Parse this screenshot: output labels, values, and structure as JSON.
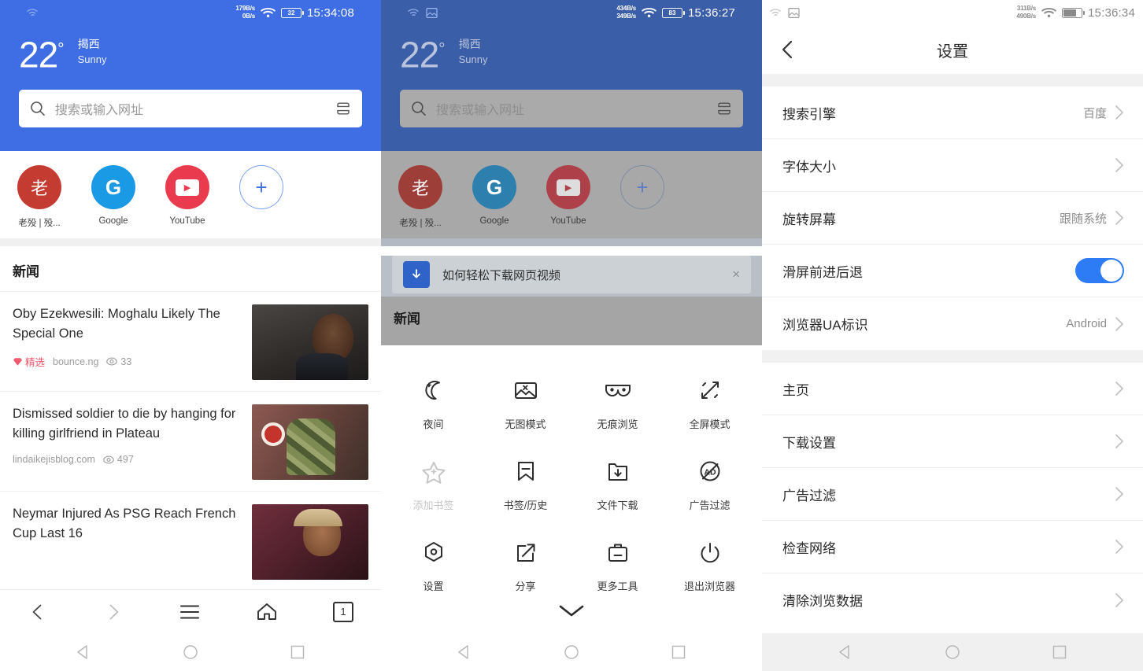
{
  "panel1": {
    "status": {
      "speed_up": "179B/s",
      "speed_down": "0B/s",
      "battery": "32",
      "time": "15:34:08"
    },
    "weather": {
      "temp": "22",
      "degree": "°",
      "city": "揭西",
      "condition": "Sunny"
    },
    "search": {
      "placeholder": "搜索或输入网址"
    },
    "shortcuts": [
      {
        "label": "老殁 | 殁...",
        "glyph": "老",
        "color": "#c43b32"
      },
      {
        "label": "Google",
        "glyph": "G",
        "color": "#1a9ae4"
      },
      {
        "label": "YouTube",
        "glyph": "▶",
        "color": "#e93b4d"
      },
      {
        "label": "",
        "glyph": "+",
        "color": ""
      }
    ],
    "news_heading": "新闻",
    "news": [
      {
        "title": "Oby Ezekwesili: Moghalu Likely The Special One",
        "badge": "精选",
        "source": "bounce.ng",
        "views": "33"
      },
      {
        "title": "Dismissed soldier to die by hanging for killing girlfriend in Plateau",
        "badge": "",
        "source": "lindaikejisblog.com",
        "views": "497"
      },
      {
        "title": "Neymar Injured As PSG Reach French Cup Last 16",
        "badge": "",
        "source": "",
        "views": ""
      }
    ],
    "toolbar": {
      "back": "back-icon",
      "forward": "forward-icon",
      "menu": "menu-icon",
      "home": "home-icon",
      "tabs": "1"
    }
  },
  "panel2": {
    "status": {
      "speed_up": "434B/s",
      "speed_down": "349B/s",
      "battery": "83",
      "time": "15:36:27"
    },
    "weather": {
      "temp": "22",
      "degree": "°",
      "city": "揭西",
      "condition": "Sunny"
    },
    "search": {
      "placeholder": "搜索或输入网址"
    },
    "shortcuts": [
      {
        "label": "老殁 | 殁...",
        "glyph": "老",
        "color": "#9e3e38"
      },
      {
        "label": "Google",
        "glyph": "G",
        "color": "#2d7fae"
      },
      {
        "label": "YouTube",
        "glyph": "▶",
        "color": "#ad4048"
      },
      {
        "label": "",
        "glyph": "+",
        "color": ""
      }
    ],
    "banner": {
      "text": "如何轻松下载网页视频",
      "close": "×"
    },
    "news_heading": "新闻",
    "menu_grid": [
      {
        "label": "夜间",
        "icon": "moon-icon",
        "dim": false
      },
      {
        "label": "无图模式",
        "icon": "no-image-icon",
        "dim": false
      },
      {
        "label": "无痕浏览",
        "icon": "incognito-mask-icon",
        "dim": false
      },
      {
        "label": "全屏模式",
        "icon": "fullscreen-icon",
        "dim": false
      },
      {
        "label": "添加书签",
        "icon": "add-bookmark-star-icon",
        "dim": true
      },
      {
        "label": "书签/历史",
        "icon": "bookmark-history-icon",
        "dim": false
      },
      {
        "label": "文件下载",
        "icon": "download-folder-icon",
        "dim": false
      },
      {
        "label": "广告过滤",
        "icon": "ad-block-icon",
        "dim": false
      },
      {
        "label": "设置",
        "icon": "settings-gear-icon",
        "dim": false
      },
      {
        "label": "分享",
        "icon": "share-icon",
        "dim": false
      },
      {
        "label": "更多工具",
        "icon": "more-tools-icon",
        "dim": false
      },
      {
        "label": "退出浏览器",
        "icon": "power-exit-icon",
        "dim": false
      }
    ],
    "collapse": "chevron-down-icon"
  },
  "panel3": {
    "status": {
      "speed_up": "311B/s",
      "speed_down": "490B/s",
      "battery": "",
      "time": "15:36:34"
    },
    "header": {
      "title": "设置",
      "back": "back-chevron-icon"
    },
    "group1": [
      {
        "label": "搜索引擎",
        "value": "百度",
        "type": "link"
      },
      {
        "label": "字体大小",
        "value": "",
        "type": "link"
      },
      {
        "label": "旋转屏幕",
        "value": "跟随系统",
        "type": "link"
      },
      {
        "label": "滑屏前进后退",
        "value": "",
        "type": "toggle",
        "on": true
      },
      {
        "label": "浏览器UA标识",
        "value": "Android",
        "type": "link"
      }
    ],
    "group2": [
      {
        "label": "主页",
        "value": "",
        "type": "link"
      },
      {
        "label": "下载设置",
        "value": "",
        "type": "link"
      },
      {
        "label": "广告过滤",
        "value": "",
        "type": "link"
      },
      {
        "label": "检查网络",
        "value": "",
        "type": "link"
      },
      {
        "label": "清除浏览数据",
        "value": "",
        "type": "link"
      }
    ]
  },
  "colors": {
    "accent_blue": "#3f6ee4",
    "toggle_on": "#2e7bf6",
    "hot_red": "#f2566a"
  }
}
